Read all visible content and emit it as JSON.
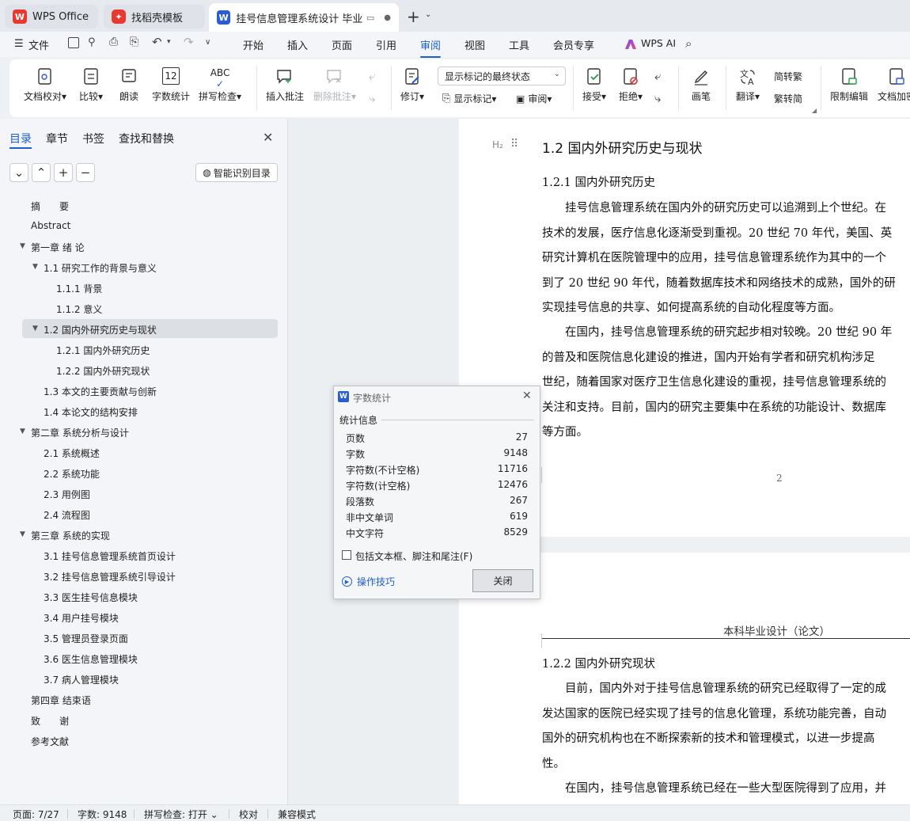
{
  "tabs": {
    "wps_office": "WPS Office",
    "template": "找稻壳模板",
    "document": "挂号信息管理系统设计 毕业论文"
  },
  "menu": {
    "file": "文件",
    "items": [
      "开始",
      "插入",
      "页面",
      "引用",
      "审阅",
      "视图",
      "工具",
      "会员专享"
    ],
    "active": "审阅",
    "wps_ai": "WPS AI"
  },
  "ribbon": {
    "doc_check": "文档校对",
    "compare": "比较",
    "read_aloud": "朗读",
    "word_count": "字数统计",
    "word_count_icon_text": "12",
    "spell_check": "拼写检查",
    "spell_icon_text": "ABC",
    "insert_comment": "插入批注",
    "delete_comment": "删除批注",
    "revise": "修订",
    "display_mode": "显示标记的最终状态",
    "show_markup": "显示标记",
    "review": "审阅",
    "accept": "接受",
    "reject": "拒绝",
    "pen": "画笔",
    "translate": "翻译",
    "to_traditional": "简转繁",
    "to_simplified": "繁转简",
    "restrict_edit": "限制编辑",
    "doc_encrypt": "文档加密"
  },
  "nav": {
    "tabs": [
      "目录",
      "章节",
      "书签",
      "查找和替换"
    ],
    "active": "目录",
    "smart_toc": "智能识别目录",
    "toc": [
      {
        "text": "摘　　要",
        "level": 0
      },
      {
        "text": "Abstract",
        "level": 0
      },
      {
        "text": "第一章 绪 论",
        "level": 0,
        "expanded": true
      },
      {
        "text": "1.1  研究工作的背景与意义",
        "level": 1,
        "expanded": true
      },
      {
        "text": "1.1.1 背景",
        "level": 2
      },
      {
        "text": "1.1.2 意义",
        "level": 2
      },
      {
        "text": "1.2  国内外研究历史与现状",
        "level": 1,
        "expanded": true,
        "selected": true
      },
      {
        "text": "1.2.1 国内外研究历史",
        "level": 2
      },
      {
        "text": "1.2.2 国内外研究现状",
        "level": 2
      },
      {
        "text": "1.3  本文的主要贡献与创新",
        "level": 1
      },
      {
        "text": "1.4  本论文的结构安排",
        "level": 1
      },
      {
        "text": "第二章  系统分析与设计",
        "level": 0,
        "expanded": true
      },
      {
        "text": "2.1  系统概述",
        "level": 1
      },
      {
        "text": "2.2  系统功能",
        "level": 1
      },
      {
        "text": "2.3  用例图",
        "level": 1
      },
      {
        "text": "2.4  流程图",
        "level": 1
      },
      {
        "text": "第三章  系统的实现",
        "level": 0,
        "expanded": true
      },
      {
        "text": "3.1  挂号信息管理系统首页设计",
        "level": 1
      },
      {
        "text": "3.2  挂号信息管理系统引导设计",
        "level": 1
      },
      {
        "text": "3.3  医生挂号信息模块",
        "level": 1
      },
      {
        "text": "3.4  用户挂号模块",
        "level": 1
      },
      {
        "text": "3.5  管理员登录页面",
        "level": 1
      },
      {
        "text": "3.6  医生信息管理模块",
        "level": 1
      },
      {
        "text": "3.7  病人管理模块",
        "level": 1
      },
      {
        "text": "第四章  结束语",
        "level": 0
      },
      {
        "text": "致　　谢",
        "level": 0
      },
      {
        "text": "参考文献",
        "level": 0
      }
    ]
  },
  "document": {
    "heading_marker": "H₂",
    "heading": "1.2  国内外研究历史与现状",
    "sub1": "1.2.1 国内外研究历史",
    "p1": [
      "　　挂号信息管理系统在国内外的研究历史可以追溯到上个世纪。在",
      "技术的发展，医疗信息化逐渐受到重视。20 世纪 70 年代，美国、英",
      "研究计算机在医院管理中的应用，挂号信息管理系统作为其中的一个",
      "到了 20 世纪 90 年代，随着数据库技术和网络技术的成熟，国外的研",
      "实现挂号信息的共享、如何提高系统的自动化程度等方面。"
    ],
    "p2": [
      "　　在国内，挂号信息管理系统的研究起步相对较晚。20 世纪 90 年",
      "的普及和医院信息化建设的推进，国内开始有学者和研究机构涉足",
      "世纪，随着国家对医疗卫生信息化建设的重视，挂号信息管理系统的",
      "关注和支持。目前，国内的研究主要集中在系统的功能设计、数据库",
      "等方面。"
    ],
    "page_number": "2",
    "page2_header": "本科毕业设计（论文）",
    "sub2": "1.2.2 国内外研究现状",
    "p3": [
      "　　目前，国内外对于挂号信息管理系统的研究已经取得了一定的成",
      "发达国家的医院已经实现了挂号的信息化管理，系统功能完善，自动",
      "国外的研究机构也在不断探索新的技术和管理模式，以进一步提高",
      "性。"
    ],
    "p4": [
      "　　在国内，挂号信息管理系统已经在一些大型医院得到了应用，并"
    ]
  },
  "dialog": {
    "title": "字数统计",
    "section": "统计信息",
    "stats": [
      {
        "label": "页数",
        "value": "27"
      },
      {
        "label": "字数",
        "value": "9148"
      },
      {
        "label": "字符数(不计空格)",
        "value": "11716"
      },
      {
        "label": "字符数(计空格)",
        "value": "12476"
      },
      {
        "label": "段落数",
        "value": "267"
      },
      {
        "label": "非中文单词",
        "value": "619"
      },
      {
        "label": "中文字符",
        "value": "8529"
      }
    ],
    "checkbox_label": "包括文本框、脚注和尾注(F)",
    "tips": "操作技巧",
    "close": "关闭"
  },
  "status": {
    "page": "页面: 7/27",
    "words": "字数: 9148",
    "spell": "拼写检查: 打开",
    "proof": "校对",
    "compat": "兼容模式"
  },
  "colors": {
    "accent": "#1d5fd1",
    "wps_red": "#e8382f",
    "word_blue": "#2a5cd6"
  }
}
